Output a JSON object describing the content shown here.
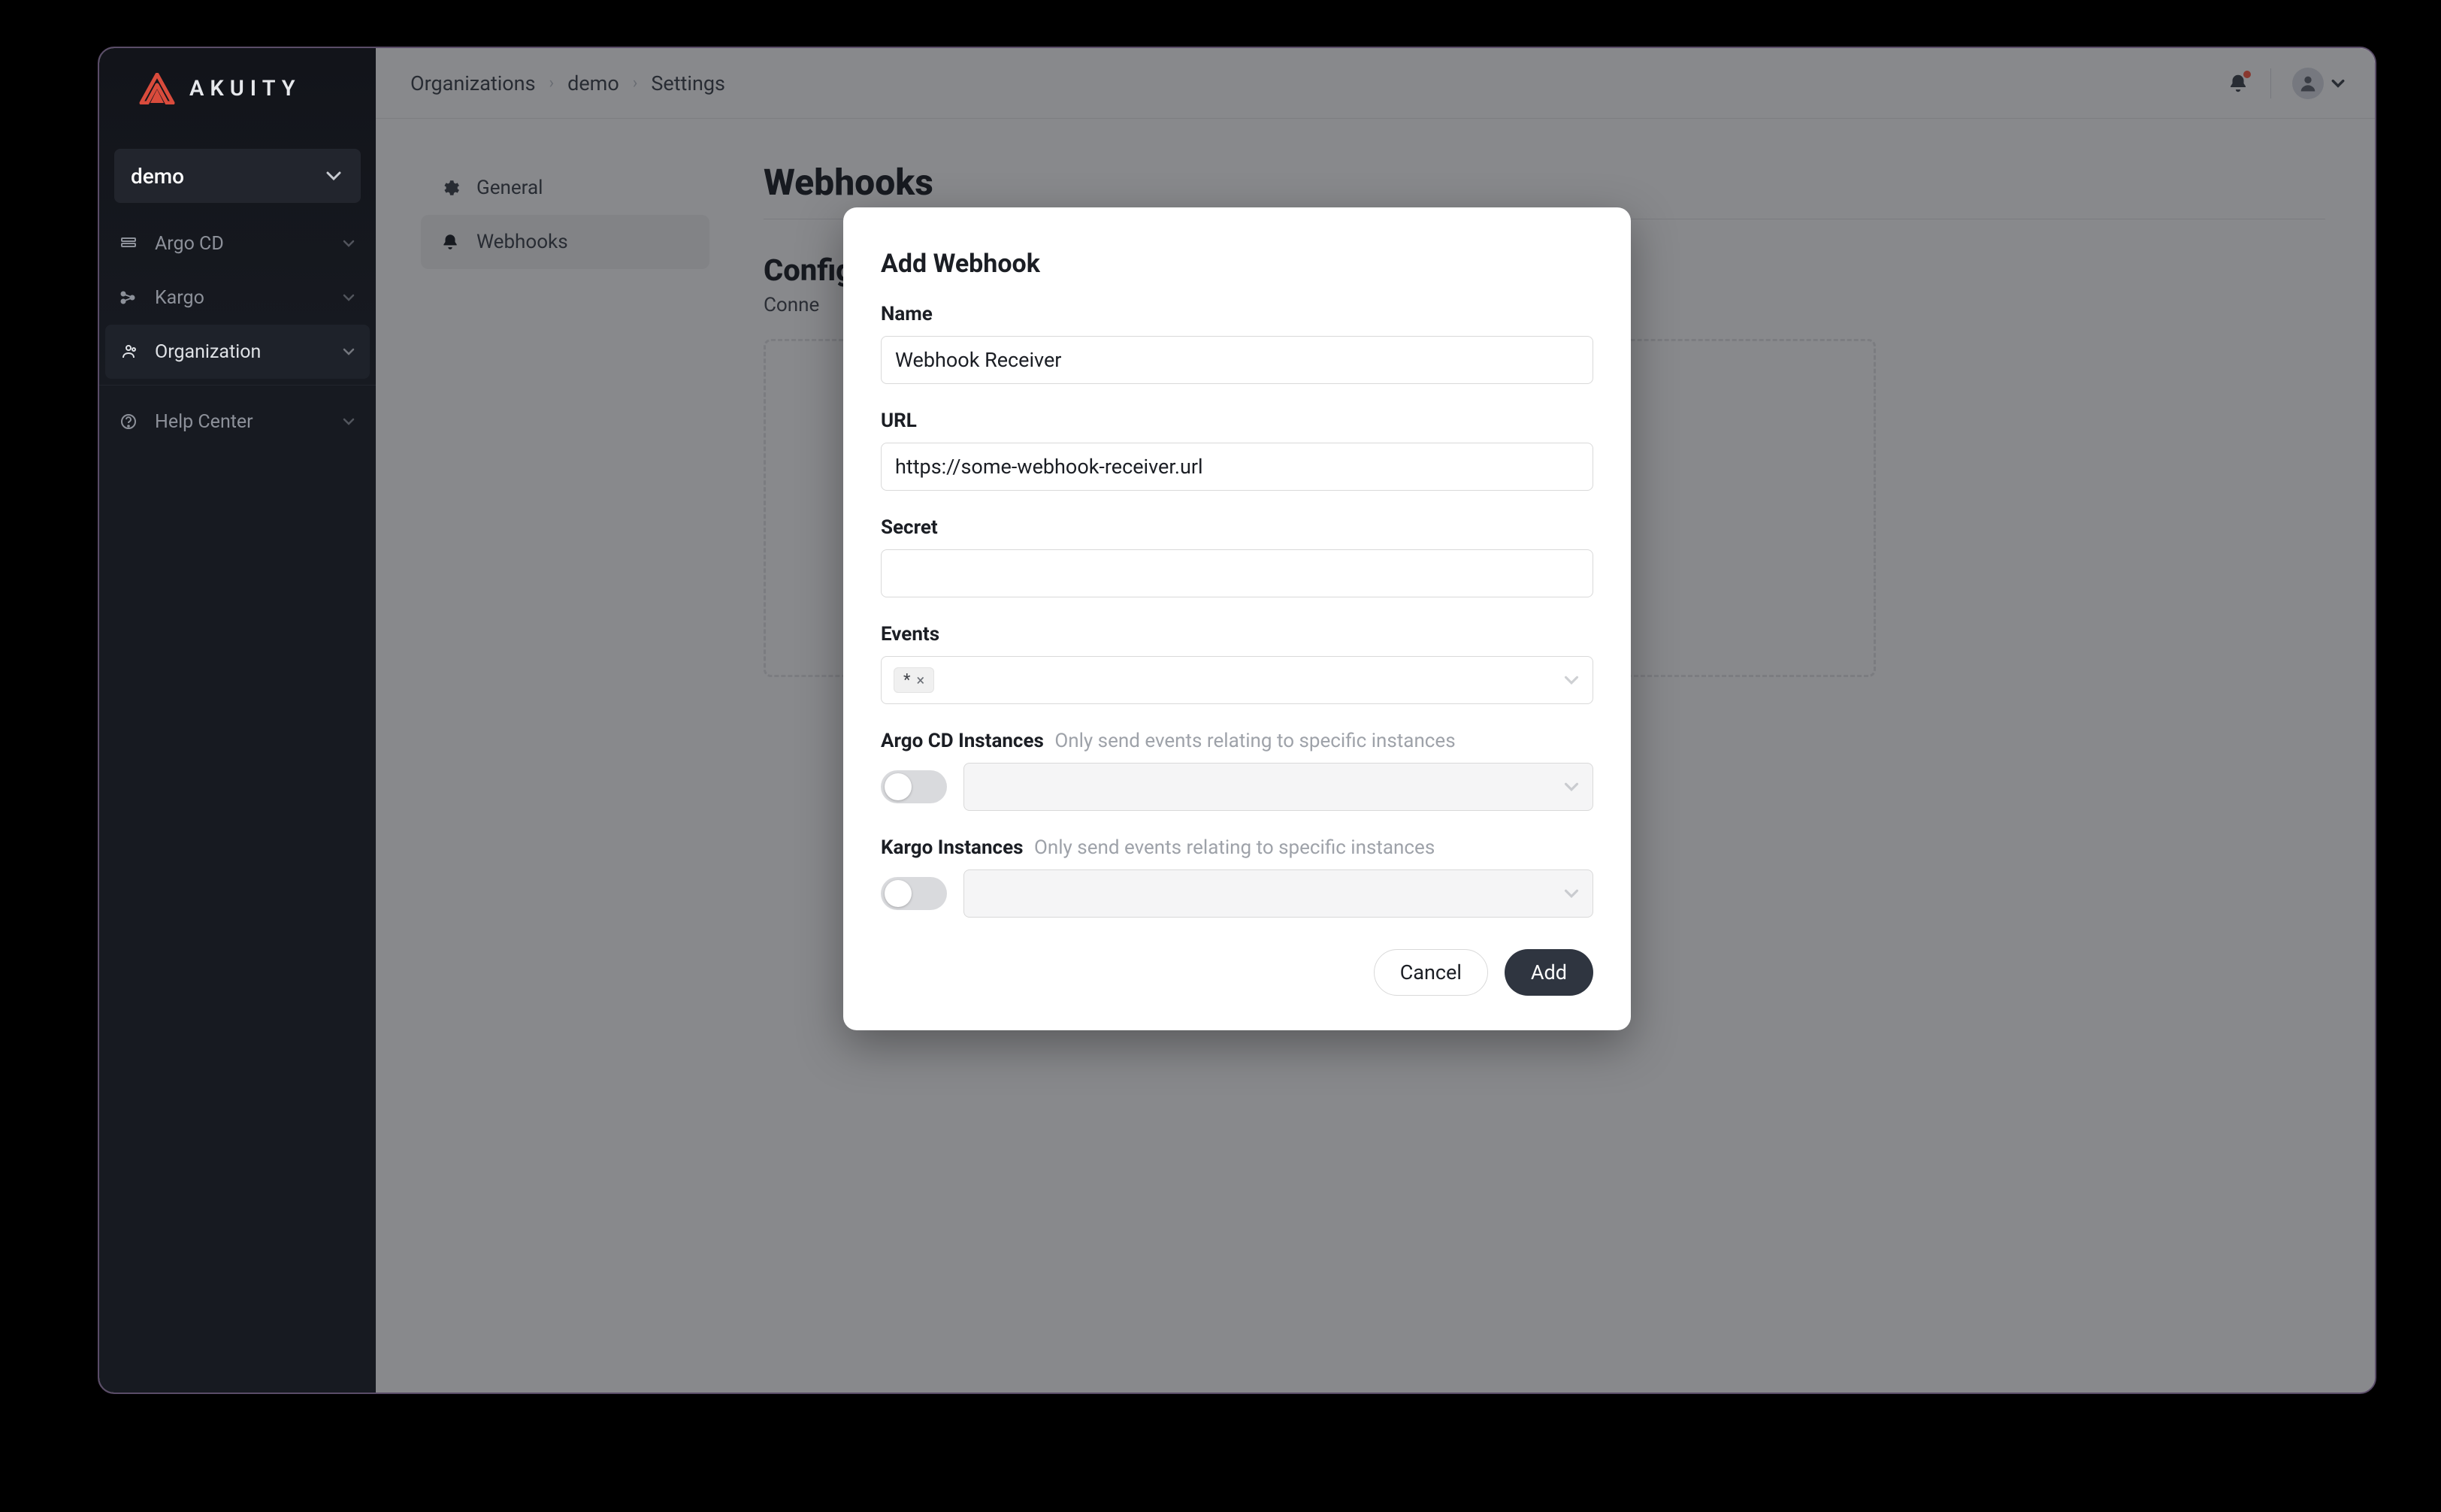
{
  "brand": {
    "name": "AKUITY"
  },
  "sidebar": {
    "org": "demo",
    "items": [
      {
        "label": "Argo CD",
        "icon": "layers-icon"
      },
      {
        "label": "Kargo",
        "icon": "share-nodes-icon"
      },
      {
        "label": "Organization",
        "icon": "org-icon"
      },
      {
        "label": "Help Center",
        "icon": "help-icon"
      }
    ]
  },
  "breadcrumbs": [
    "Organizations",
    "demo",
    "Settings"
  ],
  "settings_nav": {
    "items": [
      {
        "label": "General",
        "icon": "gear-icon"
      },
      {
        "label": "Webhooks",
        "icon": "bell-icon"
      }
    ]
  },
  "page": {
    "title": "Webhooks",
    "section_title": "Configure Webhooks",
    "section_subtitle_prefix": "Conne"
  },
  "modal": {
    "title": "Add Webhook",
    "fields": {
      "name_label": "Name",
      "name_value": "Webhook Receiver",
      "url_label": "URL",
      "url_value": "https://some-webhook-receiver.url",
      "secret_label": "Secret",
      "secret_value": "",
      "events_label": "Events",
      "events_tag": "*",
      "argo_label": "Argo CD Instances",
      "argo_hint": "Only send events relating to specific instances",
      "kargo_label": "Kargo Instances",
      "kargo_hint": "Only send events relating to specific instances"
    },
    "actions": {
      "cancel": "Cancel",
      "add": "Add"
    }
  },
  "icons": {
    "notifications": "bell-icon",
    "avatar": "avatar-icon"
  }
}
